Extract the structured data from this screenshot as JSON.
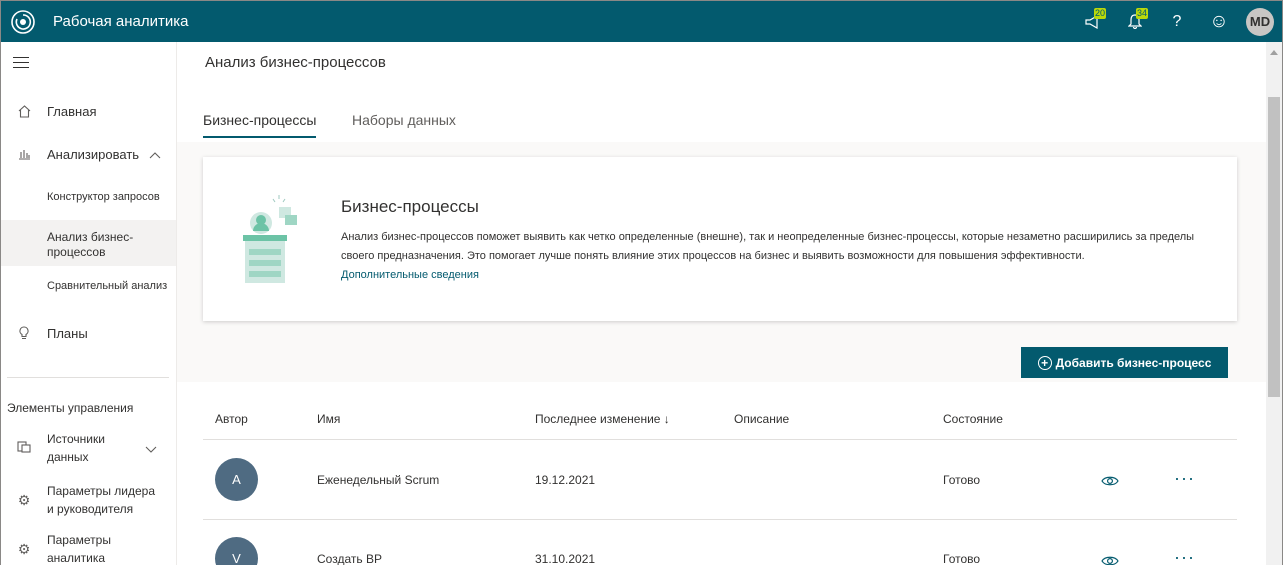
{
  "topbar": {
    "app_title": "Рабочая аналитика",
    "announcements_count": "20",
    "notifications_count": "34",
    "help_icon": "?",
    "feedback_icon": "☺",
    "user_initials": "MD"
  },
  "sidebar": {
    "home": "Главная",
    "analyze": "Анализировать",
    "query_designer": "Конструктор запросов",
    "process_analysis": "Анализ бизнес-процессов",
    "comparative_analysis": "Сравнительный анализ",
    "plans": "Планы",
    "management_section": "Элементы управления",
    "data_sources": "Источники данных",
    "leader_params": "Параметры лидера и руководителя",
    "analytics_params": "Параметры аналитика"
  },
  "main": {
    "page_title": "Анализ бизнес-процессов",
    "tabs": [
      {
        "label": "Бизнес-процессы"
      },
      {
        "label": "Наборы данных"
      }
    ],
    "card": {
      "title": "Бизнес-процессы",
      "description": "Анализ бизнес-процессов поможет выявить как четко определенные (внешне), так и неопределенные бизнес-процессы, которые незаметно расширились за пределы своего предназначения. Это помогает лучше понять влияние этих процессов на бизнес и выявить возможности для повышения эффективности.",
      "link": "Дополнительные сведения"
    },
    "add_button": "Добавить бизнес-процесс",
    "table": {
      "headers": {
        "author": "Автор",
        "name": "Имя",
        "modified": "Последнее изменение ↓",
        "description": "Описание",
        "state": "Состояние"
      },
      "rows": [
        {
          "avatar": "A",
          "name": "Еженедельный Scrum",
          "modified": "19.12.2021",
          "description": "",
          "state": "Готово"
        },
        {
          "avatar": "V",
          "name": "Создать BP",
          "modified": "31.10.2021",
          "description": "",
          "state": "Готово"
        }
      ]
    }
  },
  "colors": {
    "brand": "#035a6e",
    "badge": "#bad80a",
    "avatar": "#4f6b82"
  }
}
